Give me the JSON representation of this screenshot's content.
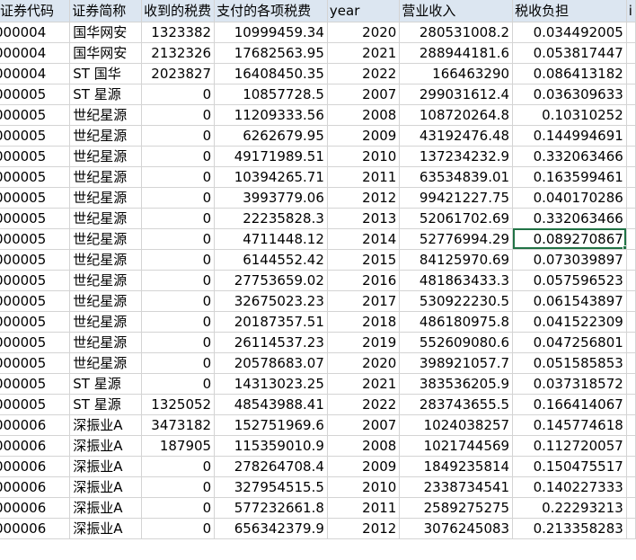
{
  "headers": [
    "证券代码",
    "证券简称",
    "收到的税费",
    "支付的各项税费",
    "year",
    "营业收入",
    "税收负担",
    "i"
  ],
  "rows": [
    [
      "000004",
      "国华网安",
      "1323382",
      "10999459.34",
      "2020",
      "280531008.2",
      "0.034492005"
    ],
    [
      "000004",
      "国华网安",
      "2132326",
      "17682563.95",
      "2021",
      "288944181.6",
      "0.053817447"
    ],
    [
      "000004",
      "ST 国华",
      "2023827",
      "16408450.35",
      "2022",
      "166463290",
      "0.086413182"
    ],
    [
      "000005",
      "ST 星源",
      "0",
      "10857728.5",
      "2007",
      "299031612.4",
      "0.036309633"
    ],
    [
      "000005",
      "世纪星源",
      "0",
      "11209333.56",
      "2008",
      "108720264.8",
      "0.10310252"
    ],
    [
      "000005",
      "世纪星源",
      "0",
      "6262679.95",
      "2009",
      "43192476.48",
      "0.144994691"
    ],
    [
      "000005",
      "世纪星源",
      "0",
      "49171989.51",
      "2010",
      "137234232.9",
      "0.332063466"
    ],
    [
      "000005",
      "世纪星源",
      "0",
      "10394265.71",
      "2011",
      "63534839.01",
      "0.163599461"
    ],
    [
      "000005",
      "世纪星源",
      "0",
      "3993779.06",
      "2012",
      "99421227.75",
      "0.040170286"
    ],
    [
      "000005",
      "世纪星源",
      "0",
      "22235828.3",
      "2013",
      "52061702.69",
      "0.332063466"
    ],
    [
      "000005",
      "世纪星源",
      "0",
      "4711448.12",
      "2014",
      "52776994.29",
      "0.089270867"
    ],
    [
      "000005",
      "世纪星源",
      "0",
      "6144552.42",
      "2015",
      "84125970.69",
      "0.073039897"
    ],
    [
      "000005",
      "世纪星源",
      "0",
      "27753659.02",
      "2016",
      "481863433.3",
      "0.057596523"
    ],
    [
      "000005",
      "世纪星源",
      "0",
      "32675023.23",
      "2017",
      "530922230.5",
      "0.061543897"
    ],
    [
      "000005",
      "世纪星源",
      "0",
      "20187357.51",
      "2018",
      "486180975.8",
      "0.041522309"
    ],
    [
      "000005",
      "世纪星源",
      "0",
      "26114537.23",
      "2019",
      "552609080.6",
      "0.047256801"
    ],
    [
      "000005",
      "世纪星源",
      "0",
      "20578683.07",
      "2020",
      "398921057.7",
      "0.051585853"
    ],
    [
      "000005",
      "ST 星源",
      "0",
      "14313023.25",
      "2021",
      "383536205.9",
      "0.037318572"
    ],
    [
      "000005",
      "ST 星源",
      "1325052",
      "48543988.41",
      "2022",
      "283743655.5",
      "0.166414067"
    ],
    [
      "000006",
      "深振业A",
      "3473182",
      "152751969.6",
      "2007",
      "1024038257",
      "0.145774618"
    ],
    [
      "000006",
      "深振业A",
      "187905",
      "115359010.9",
      "2008",
      "1021744569",
      "0.112720057"
    ],
    [
      "000006",
      "深振业A",
      "0",
      "278264708.4",
      "2009",
      "1849235814",
      "0.150475517"
    ],
    [
      "000006",
      "深振业A",
      "0",
      "327954515.5",
      "2010",
      "2338734541",
      "0.140227333"
    ],
    [
      "000006",
      "深振业A",
      "0",
      "577232661.8",
      "2011",
      "2589275275",
      "0.22293213"
    ],
    [
      "000006",
      "深振业A",
      "0",
      "656342379.9",
      "2012",
      "3076245083",
      "0.213358283"
    ]
  ],
  "selected_cell": {
    "row": 10,
    "col": 6
  }
}
